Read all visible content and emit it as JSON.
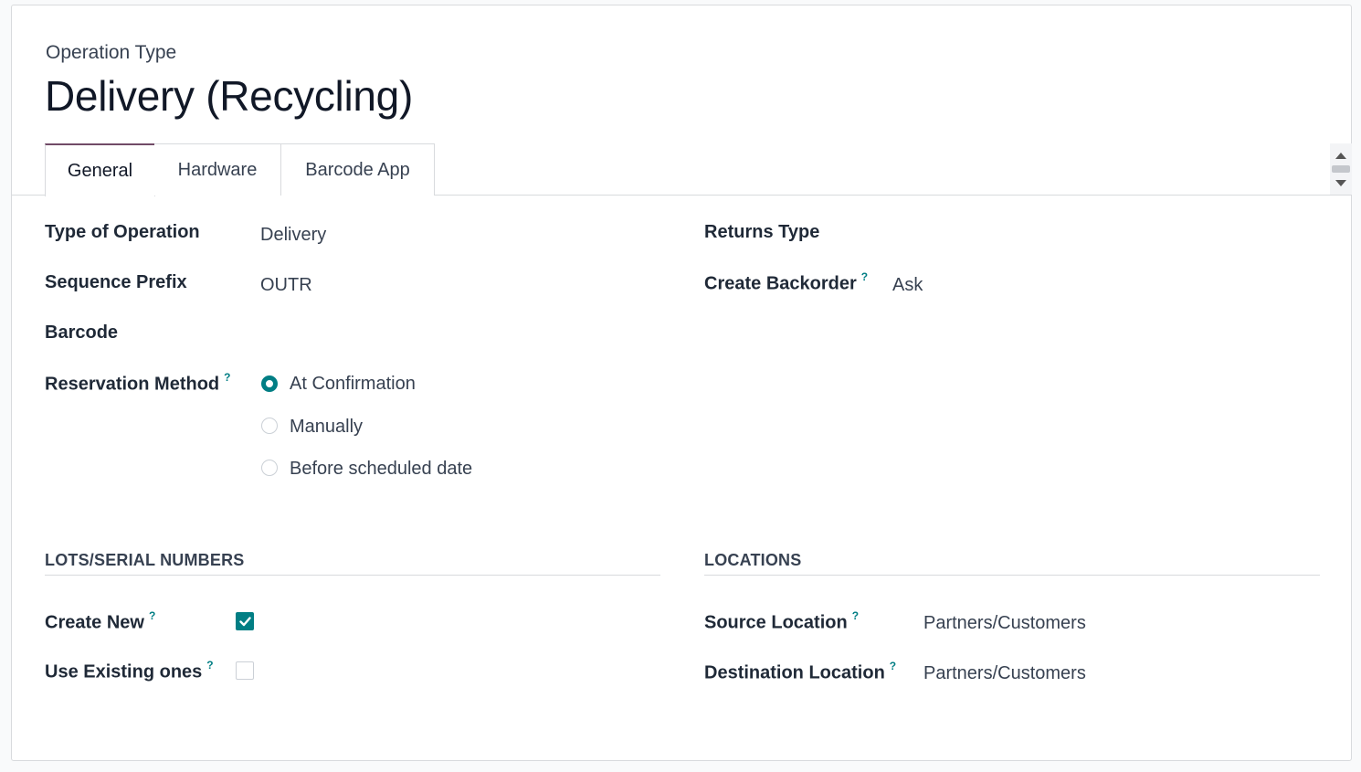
{
  "header": {
    "subtitle": "Operation Type",
    "title": "Delivery (Recycling)"
  },
  "tabs": [
    {
      "label": "General",
      "active": true
    },
    {
      "label": "Hardware",
      "active": false
    },
    {
      "label": "Barcode App",
      "active": false
    }
  ],
  "general": {
    "type_of_operation": {
      "label": "Type of Operation",
      "value": "Delivery"
    },
    "sequence_prefix": {
      "label": "Sequence Prefix",
      "value": "OUTR"
    },
    "barcode": {
      "label": "Barcode",
      "value": ""
    },
    "reservation_method": {
      "label": "Reservation Method",
      "help": "?",
      "options": [
        {
          "label": "At Confirmation",
          "checked": true
        },
        {
          "label": "Manually",
          "checked": false
        },
        {
          "label": "Before scheduled date",
          "checked": false
        }
      ]
    },
    "returns_type": {
      "label": "Returns Type",
      "value": ""
    },
    "create_backorder": {
      "label": "Create Backorder",
      "help": "?",
      "value": "Ask"
    }
  },
  "lots": {
    "section_title": "LOTS/SERIAL NUMBERS",
    "create_new": {
      "label": "Create New",
      "help": "?",
      "checked": true
    },
    "use_existing": {
      "label": "Use Existing ones",
      "help": "?",
      "checked": false
    }
  },
  "locations": {
    "section_title": "LOCATIONS",
    "source": {
      "label": "Source Location",
      "help": "?",
      "value": "Partners/Customers"
    },
    "destination": {
      "label": "Destination Location",
      "help": "?",
      "value": "Partners/Customers"
    }
  },
  "colors": {
    "accent": "#017e84",
    "active_tab_border": "#714b67"
  }
}
